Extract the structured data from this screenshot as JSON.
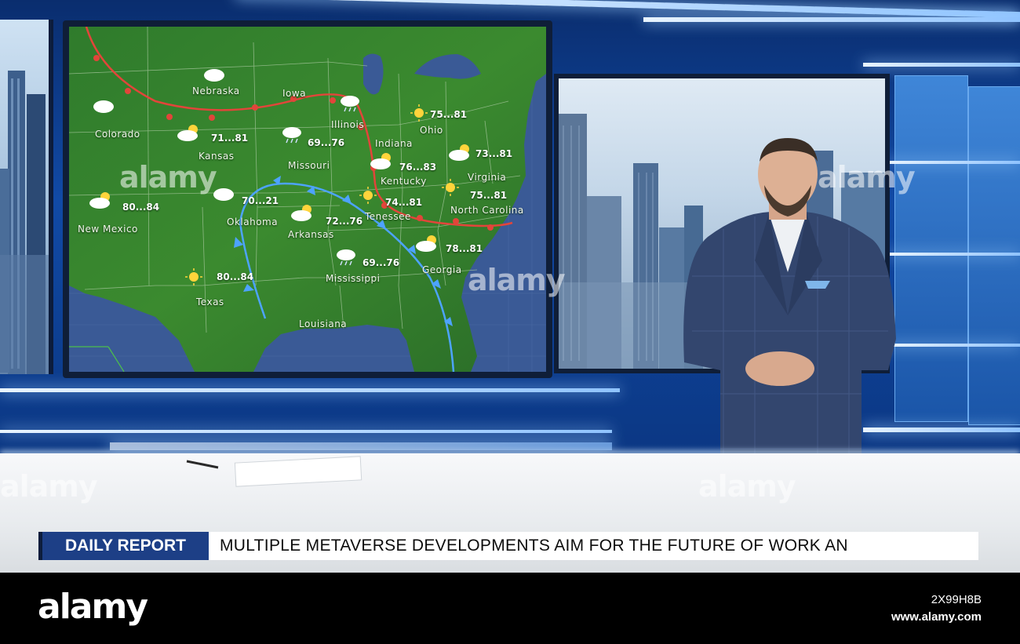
{
  "scene": {
    "description_colors": {
      "studio_blue": "#114aa6",
      "map_green": "#2f7d2e",
      "warm_front": "#e8473a",
      "cold_front": "#4da3ff",
      "ticker_badge": "#1d3f86"
    }
  },
  "map": {
    "states": [
      {
        "label": "Nebraska"
      },
      {
        "label": "Iowa"
      },
      {
        "label": "Colorado"
      },
      {
        "label": "Illinois"
      },
      {
        "label": "Ohio"
      },
      {
        "label": "Kansas"
      },
      {
        "label": "Indiana"
      },
      {
        "label": "Missouri"
      },
      {
        "label": "Kentucky"
      },
      {
        "label": "Virginia"
      },
      {
        "label": "Tenessee"
      },
      {
        "label": "North Carolina"
      },
      {
        "label": "Oklahoma"
      },
      {
        "label": "Arkansas"
      },
      {
        "label": "New Mexico"
      },
      {
        "label": "Georgia"
      },
      {
        "label": "Mississippi"
      },
      {
        "label": "Texas"
      },
      {
        "label": "Louisiana"
      }
    ],
    "temps": [
      {
        "value": "75...81",
        "icon": "sun-icon"
      },
      {
        "value": "71...81",
        "icon": "partly-cloudy-icon"
      },
      {
        "value": "69...76",
        "icon": "rain-cloud-icon"
      },
      {
        "value": "73...81",
        "icon": "partly-cloudy-icon"
      },
      {
        "value": "76...83",
        "icon": "partly-cloudy-icon"
      },
      {
        "value": "75...81",
        "icon": "sun-icon"
      },
      {
        "value": "74...81",
        "icon": "sun-icon"
      },
      {
        "value": "70...21",
        "icon": "cloud-icon"
      },
      {
        "value": "80...84",
        "icon": "partly-cloudy-icon"
      },
      {
        "value": "72...76",
        "icon": "partly-cloudy-icon"
      },
      {
        "value": "69...76",
        "icon": "rain-cloud-icon"
      },
      {
        "value": "78...81",
        "icon": "partly-cloudy-icon"
      },
      {
        "value": "80...84",
        "icon": "sun-icon"
      }
    ],
    "extra_icons": [
      "cloud-icon",
      "cloud-icon",
      "rain-cloud-icon",
      "cloud-icon"
    ]
  },
  "ticker": {
    "badge": "DAILY REPORT",
    "headline": "MULTIPLE METAVERSE DEVELOPMENTS AIM FOR THE FUTURE OF WORK AN"
  },
  "watermark": {
    "text": "alamy"
  },
  "footer": {
    "logo": "alamy",
    "image_id": "2X99H8B",
    "url": "www.alamy.com"
  }
}
